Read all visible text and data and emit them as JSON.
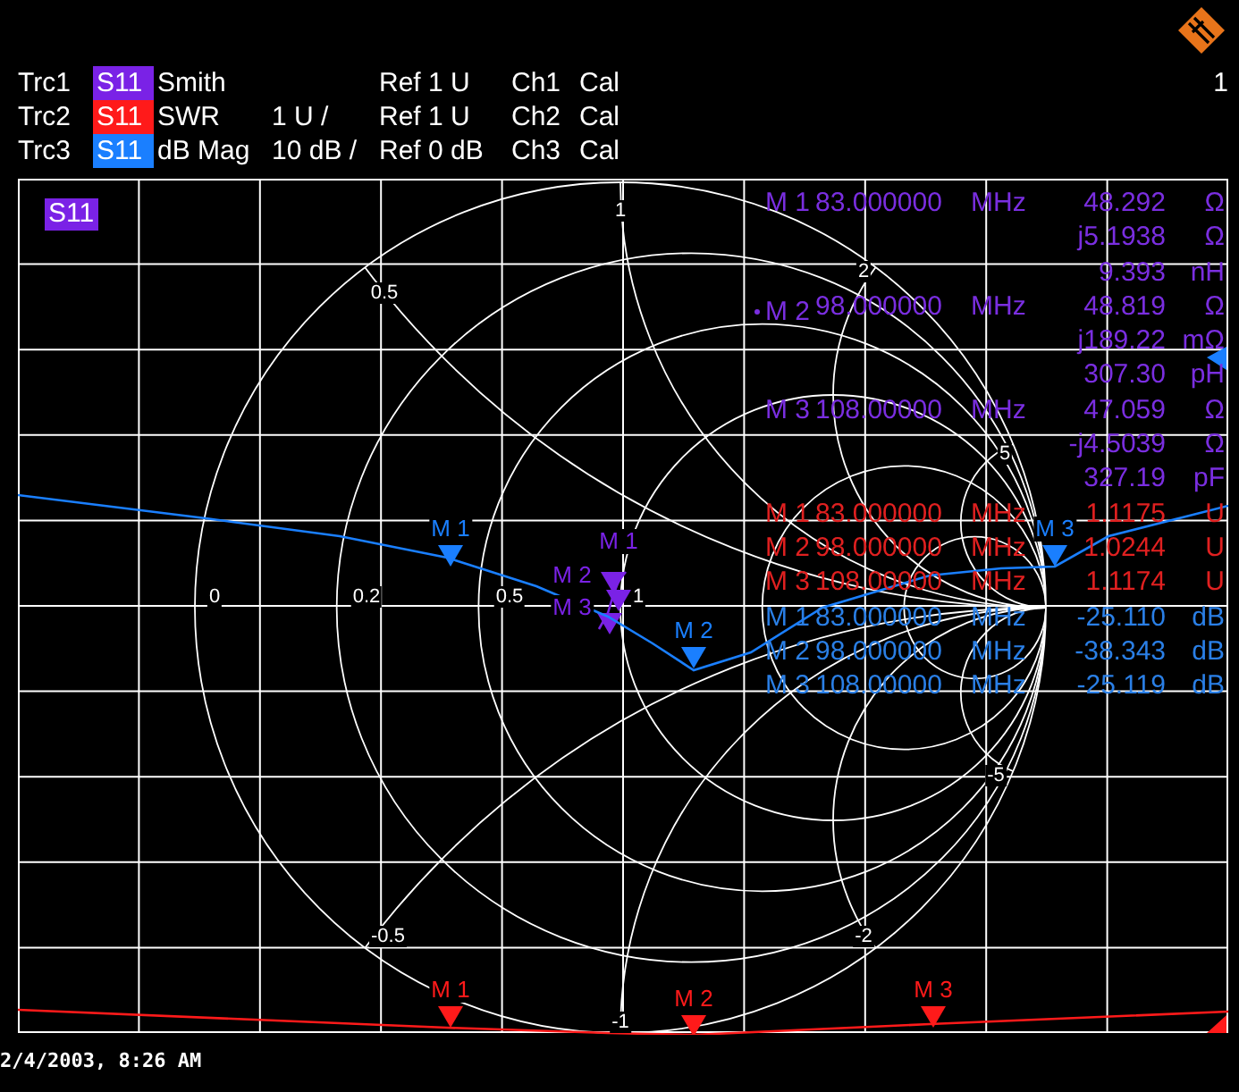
{
  "header": {
    "window_number": "1",
    "traces": [
      {
        "name": "Trc1",
        "parameter": "S11",
        "color": "#7a22e6",
        "format": "Smith",
        "reference": "Ref 1 U",
        "channel": "Ch1",
        "status": "Cal"
      },
      {
        "name": "Trc2",
        "parameter": "S11",
        "color": "#ff1a1a",
        "format": "SWR",
        "scale": "1 U /",
        "reference": "Ref 1 U",
        "channel": "Ch2",
        "status": "Cal"
      },
      {
        "name": "Trc3",
        "parameter": "S11",
        "color": "#1a7fff",
        "format": "dB Mag",
        "scale": "10 dB /",
        "reference": "Ref 0 dB",
        "channel": "Ch3",
        "status": "Cal"
      }
    ]
  },
  "diagram": {
    "trace_badge": "S11",
    "real_axis_labels": [
      "0",
      "0.2",
      "0.5",
      "1"
    ],
    "upper_labels": [
      "0.5",
      "1",
      "2",
      "5"
    ],
    "lower_labels": [
      "-0.5",
      "-1",
      "-2",
      "-5"
    ],
    "traces": [
      {
        "color": "#7a22e6",
        "markers": [
          "M 1",
          "M 2",
          "M 3"
        ]
      },
      {
        "color": "#1a7fff",
        "markers": [
          "M 1",
          "M 2",
          "M 3"
        ]
      },
      {
        "color": "#ff1a1a",
        "markers": [
          "M 1",
          "M 2",
          "M 3"
        ]
      }
    ],
    "readouts": [
      {
        "color": "#7a2ee0",
        "rows": [
          {
            "marker": "M 1",
            "active": false,
            "frequency": "83.000000",
            "frequency_unit": "MHz",
            "value": "48.292",
            "unit": "Ω"
          },
          {
            "value": "j5.1938",
            "unit": "Ω"
          },
          {
            "value": "9.393",
            "unit": "nH"
          },
          {
            "marker": "M 2",
            "active": true,
            "frequency": "98.000000",
            "frequency_unit": "MHz",
            "value": "48.819",
            "unit": "Ω"
          },
          {
            "value": "j189.22",
            "unit": "mΩ"
          },
          {
            "value": "307.30",
            "unit": "pH"
          },
          {
            "marker": "M 3",
            "active": false,
            "frequency": "108.00000",
            "frequency_unit": "MHz",
            "value": "47.059",
            "unit": "Ω"
          },
          {
            "value": "-j4.5039",
            "unit": "Ω"
          },
          {
            "value": "327.19",
            "unit": "pF"
          }
        ]
      },
      {
        "color": "#e02020",
        "rows": [
          {
            "marker": "M 1",
            "active": false,
            "frequency": "83.000000",
            "frequency_unit": "MHz",
            "value": "1.1175",
            "unit": "U"
          },
          {
            "marker": "M 2",
            "active": false,
            "frequency": "98.000000",
            "frequency_unit": "MHz",
            "value": "1.0244",
            "unit": "U"
          },
          {
            "marker": "M 3",
            "active": false,
            "frequency": "108.00000",
            "frequency_unit": "MHz",
            "value": "1.1174",
            "unit": "U"
          }
        ]
      },
      {
        "color": "#2a7fe6",
        "rows": [
          {
            "marker": "M 1",
            "active": false,
            "frequency": "83.000000",
            "frequency_unit": "MHz",
            "value": "-25.110",
            "unit": "dB"
          },
          {
            "marker": "M 2",
            "active": false,
            "frequency": "98.000000",
            "frequency_unit": "MHz",
            "value": "-38.343",
            "unit": "dB"
          },
          {
            "marker": "M 3",
            "active": false,
            "frequency": "108.00000",
            "frequency_unit": "MHz",
            "value": "-25.119",
            "unit": "dB"
          }
        ]
      }
    ]
  },
  "timestamp": "2/4/2003, 8:26 AM"
}
